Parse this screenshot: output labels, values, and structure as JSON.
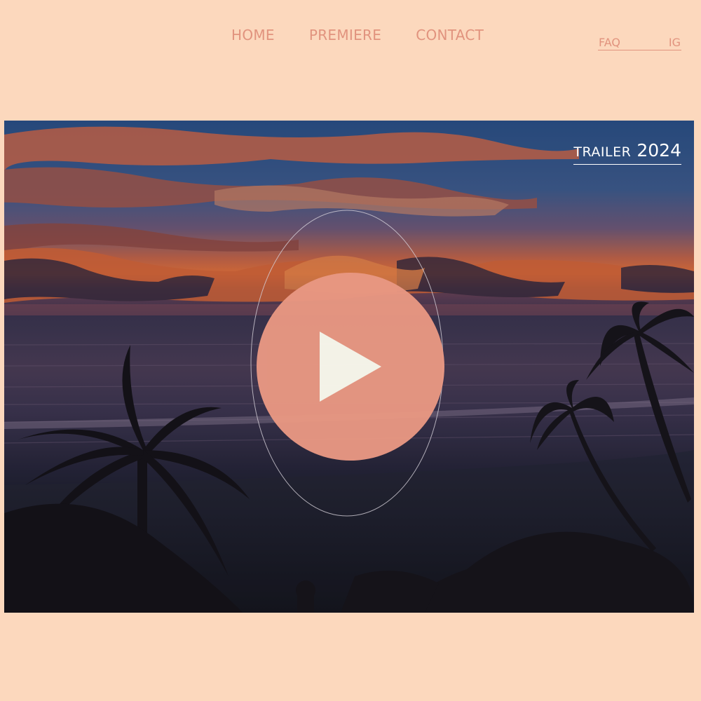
{
  "nav": {
    "items": [
      {
        "label": "HOME"
      },
      {
        "label": "PREMIERE"
      },
      {
        "label": "CONTACT"
      }
    ]
  },
  "aux": {
    "faq": "FAQ",
    "ig": "IG"
  },
  "video": {
    "tag_word": "TRAILER",
    "tag_year": "2024",
    "play_icon": "play-icon"
  },
  "colors": {
    "background": "#fcd8bd",
    "nav_text": "#e1937e",
    "play_button": "#e99883",
    "play_glyph": "#fbfaee"
  }
}
